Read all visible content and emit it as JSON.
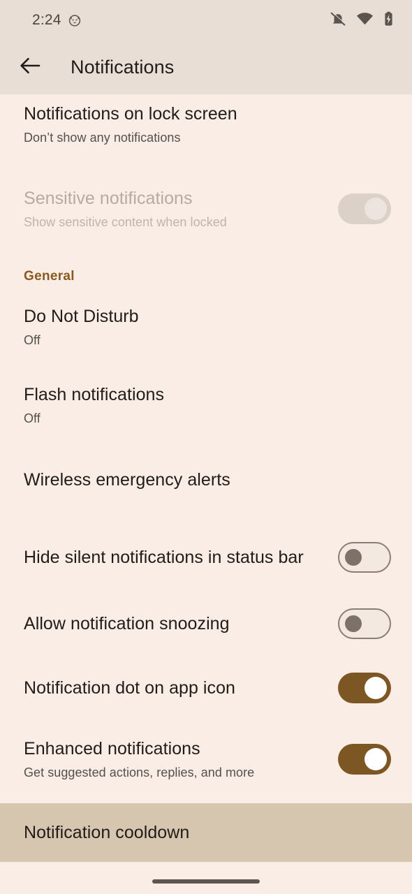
{
  "status_bar": {
    "time": "2:24",
    "notification_icon": "cat-face-icon",
    "icons": [
      "ringer-vibrate-off-icon",
      "wifi-icon",
      "battery-charging-icon"
    ]
  },
  "app_bar": {
    "back_icon": "arrow-back-icon",
    "title": "Notifications"
  },
  "colors": {
    "accent_brown": "#7D5723",
    "section_header": "#8A5A22",
    "page_background": "#F9EDE5",
    "appbar_background": "#E9DED5",
    "highlight_row": "#D7C6AF",
    "toggle_on_track": "#7D5723",
    "toggle_on_thumb": "#FFFFFF",
    "toggle_off_border": "#8A7D72",
    "toggle_off_thumb": "#7E7268",
    "disabled_text": "#B6AAA1"
  },
  "rows": {
    "lock_screen": {
      "title": "Notifications on lock screen",
      "subtitle": "Don’t show any notifications"
    },
    "sensitive": {
      "title": "Sensitive notifications",
      "subtitle": "Show sensitive content when locked",
      "toggle_state": "on-disabled"
    },
    "general_header": "General",
    "dnd": {
      "title": "Do Not Disturb",
      "subtitle": "Off"
    },
    "flash": {
      "title": "Flash notifications",
      "subtitle": "Off"
    },
    "emergency": {
      "title": "Wireless emergency alerts"
    },
    "hide_silent": {
      "title": "Hide silent notifications in status bar",
      "toggle_state": "off"
    },
    "snoozing": {
      "title": "Allow notification snoozing",
      "toggle_state": "off"
    },
    "dot": {
      "title": "Notification dot on app icon",
      "toggle_state": "on"
    },
    "enhanced": {
      "title": "Enhanced notifications",
      "subtitle": "Get suggested actions, replies, and more",
      "toggle_state": "on"
    },
    "cooldown": {
      "title": "Notification cooldown",
      "highlighted": true
    }
  },
  "nav_bar": {
    "gesture_handle": "home-gesture-pill"
  }
}
